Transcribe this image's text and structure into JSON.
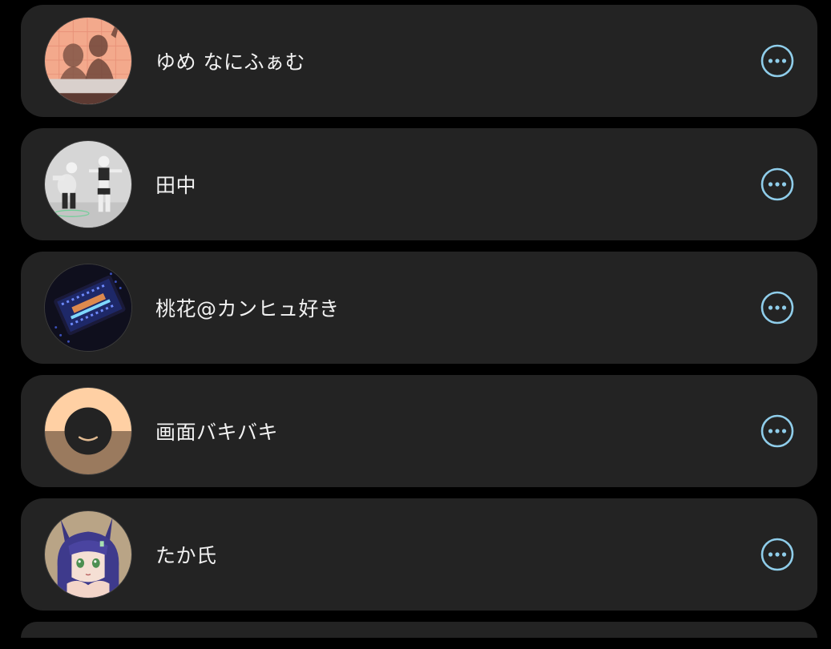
{
  "theme": {
    "background": "#000000",
    "card": "#232323",
    "text": "#f2f2f2",
    "accent": "#8fcdea"
  },
  "members": [
    {
      "name": "ゆめ なにふぁむ",
      "avatar_icon": "avatar-shadow-photo",
      "action_icon": "more-options-icon"
    },
    {
      "name": "田中",
      "avatar_icon": "avatar-3d-figures",
      "action_icon": "more-options-icon"
    },
    {
      "name": "桃花@カンヒュ好き",
      "avatar_icon": "avatar-neon-device",
      "action_icon": "more-options-icon"
    },
    {
      "name": "画面バキバキ",
      "avatar_icon": "avatar-smiley-face",
      "action_icon": "more-options-icon"
    },
    {
      "name": "たか氏",
      "avatar_icon": "avatar-anime-character",
      "action_icon": "more-options-icon"
    }
  ]
}
